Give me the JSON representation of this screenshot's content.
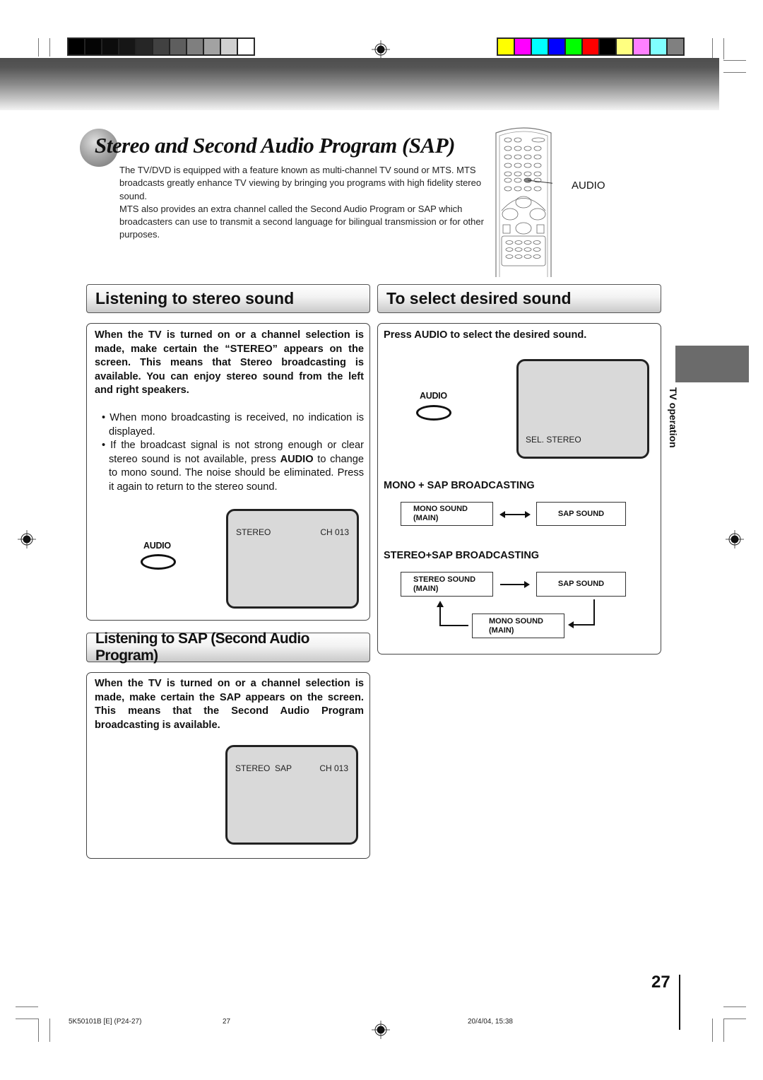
{
  "print_marks": {
    "gray_swatches": [
      "#000000",
      "#050505",
      "#0c0c0c",
      "#161616",
      "#262626",
      "#414141",
      "#5e5e5e",
      "#7f7f7f",
      "#a2a2a2",
      "#d0d0d0",
      "#ffffff"
    ],
    "color_swatches": [
      "#ffff00",
      "#ff00ff",
      "#00ffff",
      "#0000ff",
      "#00ff00",
      "#ff0000",
      "#000000",
      "#ffff80",
      "#ff80ff",
      "#80ffff",
      "#808080"
    ]
  },
  "header": {
    "title": "Stereo and Second Audio Program (SAP)",
    "intro": [
      "The TV/DVD is equipped with a feature known as multi-channel TV sound or MTS. MTS broadcasts greatly enhance TV viewing by bringing you programs with high fidelity stereo sound.",
      "MTS also provides an extra channel called the Second Audio Program or SAP which broadcasters can use to transmit a second language for bilingual transmission or for other purposes."
    ],
    "remote_callout": "AUDIO"
  },
  "stereo_section": {
    "heading": "Listening to stereo sound",
    "lead": "When the TV is turned on or a channel selection is made, make certain the “STEREO” appears on the screen. This means that Stereo broadcasting is available. You can enjoy stereo sound from the left and right speakers.",
    "bullet1": "When mono broadcasting is received, no indication is displayed.",
    "bullet2_pre": "If the broadcast signal is not strong enough or clear stereo sound is not available, press ",
    "bullet2_bold": "AUDIO",
    "bullet2_post": " to change to mono sound. The noise should be eliminated. Press it again to return to the stereo sound.",
    "button_label": "AUDIO",
    "screen_left": "STEREO",
    "screen_right": "CH 013"
  },
  "sap_section": {
    "heading": "Listening to SAP (Second Audio Program)",
    "lead": "When the TV is turned on or a channel selection is made, make certain the SAP appears on the screen. This means that the Second Audio Program broadcasting is available.",
    "screen_left": "STEREO  SAP",
    "screen_right": "CH 013"
  },
  "select_section": {
    "heading": "To select desired sound",
    "instruction": "Press AUDIO to select the desired sound.",
    "button_label": "AUDIO",
    "screen_text": "SEL. STEREO",
    "mono_sap": {
      "heading": "MONO + SAP BROADCASTING",
      "box1_line1": "MONO SOUND",
      "box1_line2": "(MAIN)",
      "box2": "SAP SOUND"
    },
    "stereo_sap": {
      "heading": "STEREO+SAP BROADCASTING",
      "box1_line1": "STEREO SOUND",
      "box1_line2": "(MAIN)",
      "box2": "SAP SOUND",
      "box3_line1": "MONO SOUND",
      "box3_line2": "(MAIN)"
    }
  },
  "side_tab": {
    "label": "TV operation"
  },
  "page_number": "27",
  "footer": {
    "code": "5K50101B [E] (P24-27)",
    "page": "27",
    "date": "20/4/04, 15:38"
  }
}
